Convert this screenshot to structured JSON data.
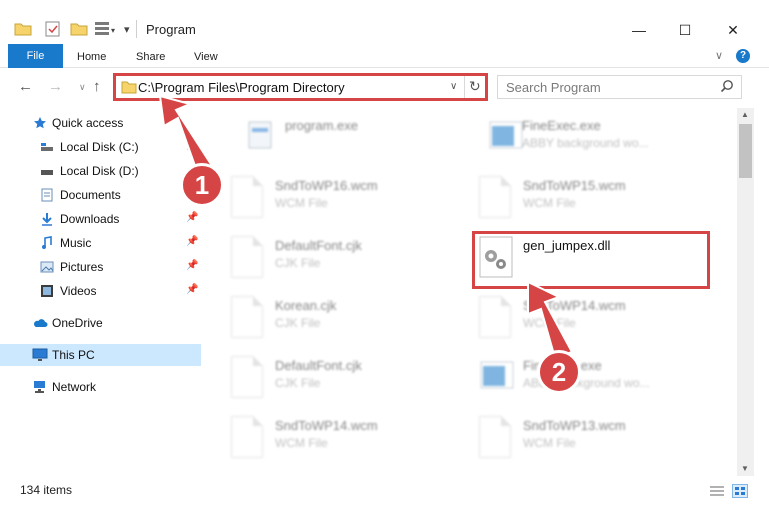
{
  "window": {
    "title": "Program",
    "min_glyph": "—",
    "max_glyph": "☐",
    "close_glyph": "✕"
  },
  "ribbon": {
    "tabs": [
      "File",
      "Home",
      "Share",
      "View"
    ],
    "chevron": "∨",
    "help": "?"
  },
  "address": {
    "path": "C:\\Program Files\\Program Directory",
    "chevron": "∨",
    "refresh": "↻"
  },
  "nav": {
    "back": "←",
    "forward": "→",
    "recent": "∨",
    "up": "↑"
  },
  "search": {
    "placeholder": "Search Program",
    "icon": "search-icon"
  },
  "sidebar": {
    "items": [
      {
        "label": "Quick access",
        "icon": "star-icon",
        "pinned": false
      },
      {
        "label": "Local Disk (C:)",
        "icon": "drive-icon",
        "pinned": true
      },
      {
        "label": "Local Disk (D:)",
        "icon": "drive-icon",
        "pinned": false
      },
      {
        "label": "Documents",
        "icon": "documents-icon",
        "pinned": true
      },
      {
        "label": "Downloads",
        "icon": "downloads-icon",
        "pinned": true
      },
      {
        "label": "Music",
        "icon": "music-icon",
        "pinned": true
      },
      {
        "label": "Pictures",
        "icon": "pictures-icon",
        "pinned": true
      },
      {
        "label": "Videos",
        "icon": "videos-icon",
        "pinned": true
      },
      {
        "label": "OneDrive",
        "icon": "cloud-icon",
        "pinned": false
      },
      {
        "label": "This PC",
        "icon": "computer-icon",
        "pinned": false,
        "selected": true
      },
      {
        "label": "Network",
        "icon": "network-icon",
        "pinned": false
      }
    ],
    "pin_glyph": "📌"
  },
  "files": [
    {
      "name": "program.exe",
      "type": "",
      "icon": "exe-icon",
      "blurred": true
    },
    {
      "name": "FineExec.exe",
      "type": "ABBY background wo...",
      "icon": "app-icon",
      "blurred": true
    },
    {
      "name": "SndToWP16.wcm",
      "type": "WCM File",
      "icon": "doc-icon",
      "blurred": true
    },
    {
      "name": "SndToWP15.wcm",
      "type": "WCM File",
      "icon": "doc-icon",
      "blurred": true
    },
    {
      "name": "DefaultFont.cjk",
      "type": "CJK File",
      "icon": "doc-icon",
      "blurred": true
    },
    {
      "name": "gen_jumpex.dll",
      "type": "",
      "icon": "dll-gear-icon",
      "blurred": false
    },
    {
      "name": "Korean.cjk",
      "type": "CJK File",
      "icon": "doc-icon",
      "blurred": true
    },
    {
      "name": "SndToWP14.wcm",
      "type": "WCM File",
      "icon": "doc-icon",
      "blurred": true
    },
    {
      "name": "DefaultFont.cjk",
      "type": "CJK File",
      "icon": "doc-icon",
      "blurred": true
    },
    {
      "name": "FineExec.exe",
      "type": "ABBY background wo...",
      "icon": "app-icon",
      "blurred": true
    },
    {
      "name": "SndToWP14.wcm",
      "type": "WCM File",
      "icon": "doc-icon",
      "blurred": true
    },
    {
      "name": "SndToWP13.wcm",
      "type": "WCM File",
      "icon": "doc-icon",
      "blurred": true
    }
  ],
  "status": {
    "item_count": "134 items"
  },
  "annotations": {
    "badge_1": "1",
    "badge_2": "2",
    "accent": "#d64545"
  },
  "colors": {
    "file_tab": "#1979ca",
    "selected": "#cce8ff"
  }
}
